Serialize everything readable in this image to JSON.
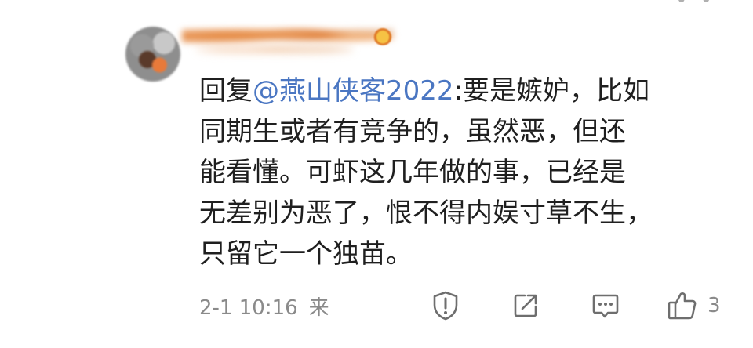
{
  "header": {
    "more_glyph": "• •",
    "avatar_icon": "avatar-blurred",
    "username_icon": "blurred-username",
    "badge_icon": "emoji-badge-icon"
  },
  "comment": {
    "reply_prefix": "回复",
    "mention": "@燕山侠客2022",
    "lines": [
      ":要是嫉妒，比如",
      "同期生或者有竞争的，虽然恶，但还",
      "能看懂。可虾这几年做的事，已经是",
      "无差别为恶了，恨不得内娱寸草不生，",
      "只留它一个独苗。"
    ]
  },
  "meta": {
    "timestamp": "2-1 10:16",
    "source_prefix": "来"
  },
  "actions": {
    "report_icon": "report-shield-icon",
    "share_icon": "share-icon",
    "reply_icon": "comment-icon",
    "like_icon": "thumbs-up-icon",
    "like_count": "3"
  },
  "colors": {
    "mention": "#4a76c2",
    "text": "#1f1f1f",
    "meta": "#8a8a8a",
    "icon": "#6e6e6e"
  }
}
